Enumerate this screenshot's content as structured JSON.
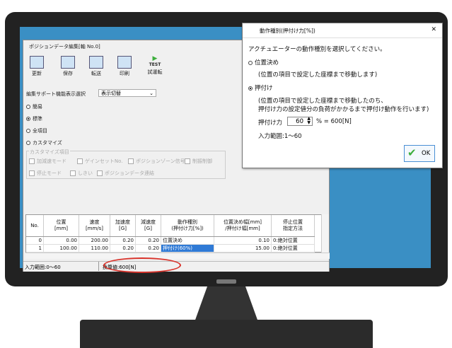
{
  "editor": {
    "title": "ポジションデータ編集[軸 No.0]",
    "toolbar": [
      {
        "label": "更新",
        "icon": "update-icon"
      },
      {
        "label": "保存",
        "icon": "save-icon"
      },
      {
        "label": "転送",
        "icon": "transfer-icon"
      },
      {
        "label": "印刷",
        "icon": "printer-icon"
      },
      {
        "label": "試運転",
        "icon": "test-run-icon",
        "icon_text": "TEST"
      }
    ],
    "support_label": "編集サポート機能表示選択",
    "support_select": "表示切替",
    "modes": [
      {
        "label": "簡易",
        "selected": false
      },
      {
        "label": "標準",
        "selected": true
      },
      {
        "label": "全項目",
        "selected": false
      },
      {
        "label": "カスタマイズ",
        "selected": false
      }
    ],
    "custom_group": "カスタマイズ項目",
    "custom_items_row1": [
      "加減速モード",
      "ゲインセットNo.",
      "ポジションゾーン信号",
      "制振制御"
    ],
    "custom_items_row2": [
      "停止モード",
      "しきい",
      "ポジションデータ連結"
    ],
    "table": {
      "headers": [
        "No.",
        "位置\n[mm]",
        "速度\n[mm/s]",
        "加速度\n[G]",
        "減速度\n[G]",
        "動作種別\n(押付け力[%])",
        "位置決め幅[mm]\n/押付け幅[mm]",
        "停止位置\n指定方法"
      ],
      "rows": [
        [
          "0",
          "0.00",
          "200.00",
          "0.20",
          "0.20",
          "位置決め",
          "0.10",
          "0:絶対位置"
        ],
        [
          "1",
          "100.00",
          "110.00",
          "0.20",
          "0.20",
          "押付け(60%)",
          "15.00",
          "0:絶対位置"
        ]
      ]
    },
    "status_range": "入力範囲:0〜60",
    "status_converted": "換算値:600[N]"
  },
  "dialog": {
    "title": "動作種別(押付け力[%])",
    "close": "✕",
    "prompt": "アクチュエーターの動作種別を選択してください。",
    "option1": "位置決め",
    "option1_desc": "(位置の項目で設定した座標まで移動します)",
    "option2": "押付け",
    "option2_desc1": "(位置の項目で設定した座標まで移動したのち、",
    "option2_desc2": "押付け力の設定値分の負荷がかかるまで押付け動作を行います)",
    "force_label": "押付け力",
    "force_value": "60",
    "force_result": "% = 600[N]",
    "range": "入力範囲:1〜60",
    "ok": "OK"
  },
  "colors": {
    "screen": "#3a8fc4",
    "selected_cell": "#2f7ad6",
    "highlight_ellipse": "#d9332b",
    "ok_check": "#3cae3c"
  }
}
